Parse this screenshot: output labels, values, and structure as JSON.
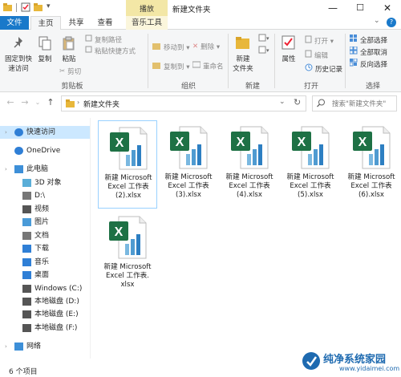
{
  "window": {
    "title": "新建文件夹",
    "context_tab": "播放",
    "controls": {
      "minimize": "—",
      "maximize": "☐",
      "close": "✕"
    }
  },
  "tabs": [
    {
      "label": "文件"
    },
    {
      "label": "主页"
    },
    {
      "label": "共享"
    },
    {
      "label": "查看"
    },
    {
      "label": "音乐工具"
    }
  ],
  "ribbon": {
    "clipboard": {
      "pin": "固定到快\n速访问",
      "copy": "复制",
      "paste": "粘贴",
      "copy_path": "复制路径",
      "paste_shortcut": "粘贴快捷方式",
      "cut": "剪切",
      "label": "剪贴板"
    },
    "organize": {
      "move_to": "移动到",
      "delete": "删除",
      "copy_to": "复制到",
      "rename": "重命名",
      "label": "组织"
    },
    "new": {
      "new_folder": "新建\n文件夹",
      "label": "新建"
    },
    "open": {
      "properties": "属性",
      "open": "打开",
      "edit": "编辑",
      "history": "历史记录",
      "label": "打开"
    },
    "select": {
      "select_all": "全部选择",
      "select_none": "全部取消",
      "invert": "反向选择",
      "label": "选择"
    }
  },
  "address": {
    "path": "新建文件夹",
    "search_placeholder": "搜索\"新建文件夹\""
  },
  "nav_pane": [
    {
      "label": "快速访问",
      "icon": "star-icon",
      "selected": true
    },
    {
      "label": "OneDrive",
      "icon": "cloud-icon"
    },
    {
      "label": "此电脑",
      "icon": "computer-icon"
    },
    {
      "label": "3D 对象",
      "icon": "cube-icon"
    },
    {
      "label": "D:\\",
      "icon": "drive-icon"
    },
    {
      "label": "视频",
      "icon": "video-icon"
    },
    {
      "label": "图片",
      "icon": "picture-icon"
    },
    {
      "label": "文档",
      "icon": "document-icon"
    },
    {
      "label": "下载",
      "icon": "download-icon"
    },
    {
      "label": "音乐",
      "icon": "music-icon"
    },
    {
      "label": "桌面",
      "icon": "desktop-icon"
    },
    {
      "label": "Windows (C:)",
      "icon": "windows-drive-icon"
    },
    {
      "label": "本地磁盘 (D:)",
      "icon": "disk-icon"
    },
    {
      "label": "本地磁盘 (E:)",
      "icon": "disk-icon"
    },
    {
      "label": "本地磁盘 (F:)",
      "icon": "disk-icon"
    },
    {
      "label": "网络",
      "icon": "network-icon"
    }
  ],
  "files": [
    {
      "name": "新建 Microsoft Excel 工作表 (2).xlsx",
      "l1": "新建 Microsoft",
      "l2": "Excel 工作表",
      "l3": "(2).xlsx"
    },
    {
      "name": "新建 Microsoft Excel 工作表 (3).xlsx",
      "l1": "新建 Microsoft",
      "l2": "Excel 工作表",
      "l3": "(3).xlsx"
    },
    {
      "name": "新建 Microsoft Excel 工作表 (4).xlsx",
      "l1": "新建 Microsoft",
      "l2": "Excel 工作表",
      "l3": "(4).xlsx"
    },
    {
      "name": "新建 Microsoft Excel 工作表 (5).xlsx",
      "l1": "新建 Microsoft",
      "l2": "Excel 工作表",
      "l3": "(5).xlsx"
    },
    {
      "name": "新建 Microsoft Excel 工作表 (6).xlsx",
      "l1": "新建 Microsoft",
      "l2": "Excel 工作表",
      "l3": "(6).xlsx"
    },
    {
      "name": "新建 Microsoft Excel 工作表.xlsx",
      "l1": "新建 Microsoft",
      "l2": "Excel 工作表.",
      "l3": "xlsx"
    }
  ],
  "status": {
    "count": "6 个项目"
  },
  "watermark": {
    "text": "纯净系统家园",
    "url": "www.yidaimei.com"
  },
  "colors": {
    "accent": "#1979ca",
    "excel_green": "#1e7145",
    "selection": "#cce8ff",
    "context_tab": "#f3e7a6"
  }
}
